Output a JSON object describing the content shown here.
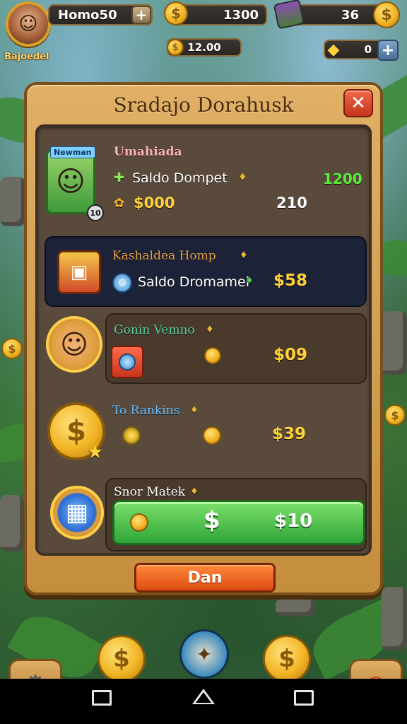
{
  "top_bar": {
    "player_label": "Homo50",
    "username": "Bajoedel",
    "coins": "1300",
    "gems": "36",
    "sub_coins": "12.00",
    "stars": "0"
  },
  "panel": {
    "title": "Sradajo Dorahusk",
    "close_label": "✕",
    "profile": {
      "name": "Umahiada",
      "badge": "Newman",
      "level": "10",
      "wallet_label": "Saldo Dompet",
      "wallet_value": "1200",
      "coin_amount": "$000",
      "count": "210"
    },
    "rows": [
      {
        "title": "Kashaldea Homp",
        "subtitle": "Saldo Dromamei",
        "value": "$58"
      },
      {
        "title": "Gonin Vemno",
        "value": "$09"
      },
      {
        "title": "To Rankins",
        "value": "$39"
      },
      {
        "title": "Snor Matek",
        "button_symbol": "$",
        "value": "$10"
      }
    ],
    "action_label": "Dan"
  },
  "colors": {
    "panel": "#c58e3e",
    "accent_green": "#2fa638",
    "accent_orange": "#dd4a12",
    "gold_text": "#ffd23a"
  }
}
